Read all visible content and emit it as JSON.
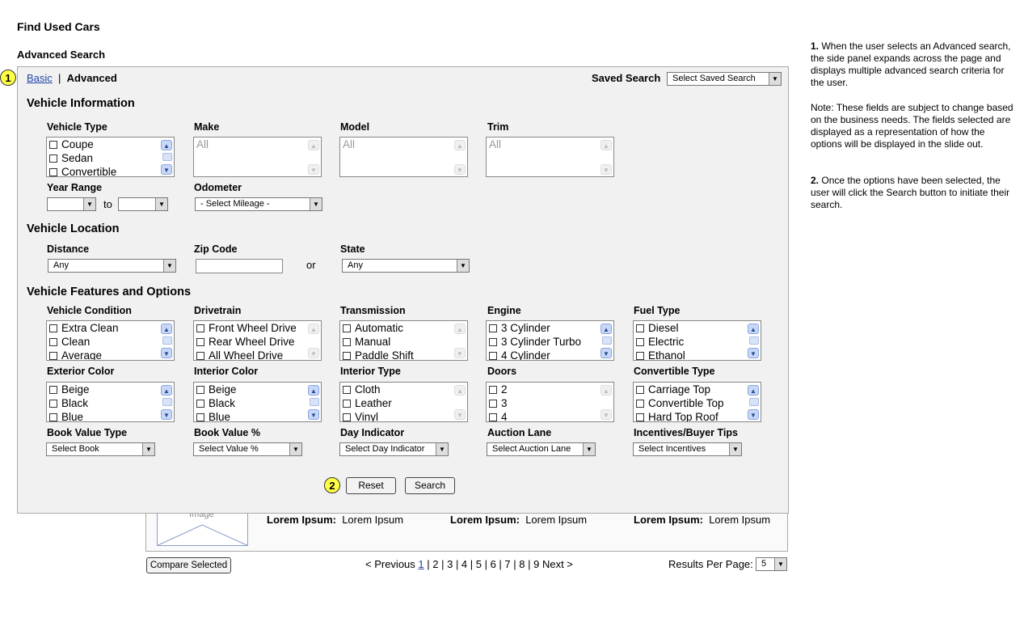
{
  "page": {
    "title": "Find Used Cars",
    "subtitle": "Advanced Search"
  },
  "tabs": {
    "basic": "Basic",
    "separator": "|",
    "advanced": "Advanced"
  },
  "saved_search": {
    "label": "Saved Search",
    "select_value": "Select Saved Search"
  },
  "badges": {
    "one": "1",
    "two": "2"
  },
  "sections": {
    "vehicle_information": "Vehicle Information",
    "vehicle_location": "Vehicle Location",
    "features": "Vehicle Features and Options"
  },
  "vehicle_info": {
    "vehicle_type": {
      "label": "Vehicle Type",
      "options": [
        "Coupe",
        "Sedan",
        "Convertible"
      ]
    },
    "make": {
      "label": "Make",
      "placeholder": "All"
    },
    "model": {
      "label": "Model",
      "placeholder": "All"
    },
    "trim": {
      "label": "Trim",
      "placeholder": "All"
    },
    "year_range": {
      "label": "Year Range",
      "to": "to"
    },
    "odometer": {
      "label": "Odometer",
      "select_value": "- Select Mileage -"
    }
  },
  "location": {
    "distance": {
      "label": "Distance",
      "select_value": "Any"
    },
    "zip": {
      "label": "Zip Code"
    },
    "or": "or",
    "state": {
      "label": "State",
      "select_value": "Any"
    }
  },
  "features": {
    "vehicle_condition": {
      "label": "Vehicle Condition",
      "options": [
        "Extra Clean",
        "Clean",
        "Average"
      ]
    },
    "drivetrain": {
      "label": "Drivetrain",
      "options": [
        "Front Wheel Drive",
        "Rear Wheel Drive",
        "All Wheel Drive"
      ]
    },
    "transmission": {
      "label": "Transmission",
      "options": [
        "Automatic",
        "Manual",
        "Paddle Shift"
      ]
    },
    "engine": {
      "label": "Engine",
      "options": [
        "3 Cylinder",
        "3 Cylinder Turbo",
        "4 Cylinder"
      ]
    },
    "fuel_type": {
      "label": "Fuel Type",
      "options": [
        "Diesel",
        "Electric",
        "Ethanol"
      ]
    },
    "exterior_color": {
      "label": "Exterior Color",
      "options": [
        "Beige",
        "Black",
        "Blue"
      ]
    },
    "interior_color": {
      "label": "Interior Color",
      "options": [
        "Beige",
        "Black",
        "Blue"
      ]
    },
    "interior_type": {
      "label": "Interior Type",
      "options": [
        "Cloth",
        "Leather",
        "Vinyl"
      ]
    },
    "doors": {
      "label": "Doors",
      "options": [
        "2",
        "3",
        "4"
      ]
    },
    "convertible_type": {
      "label": "Convertible Type",
      "options": [
        "Carriage Top",
        "Convertible Top",
        "Hard Top Roof"
      ]
    },
    "book_value_type": {
      "label": "Book Value Type",
      "select_value": "Select Book"
    },
    "book_value_pct": {
      "label": "Book Value %",
      "select_value": "Select Value %"
    },
    "day_indicator": {
      "label": "Day Indicator",
      "select_value": "Select Day Indicator"
    },
    "auction_lane": {
      "label": "Auction Lane",
      "select_value": "Select Auction Lane"
    },
    "incentives": {
      "label": "Incentives/Buyer Tips",
      "select_value": "Select Incentives"
    }
  },
  "buttons": {
    "reset": "Reset",
    "search": "Search",
    "compare": "Compare Selected"
  },
  "results": {
    "image_placeholder": "Image",
    "items": [
      {
        "label": "Lorem Ipsum:",
        "value": "Lorem Ipsum"
      },
      {
        "label": "Lorem Ipsum:",
        "value": "Lorem Ipsum"
      },
      {
        "label": "Lorem Ipsum:",
        "value": "Lorem Ipsum"
      }
    ]
  },
  "pagination": {
    "previous": "< Previous",
    "current": "1",
    "pages": "| 2 | 3 | 4 | 5 | 6 | 7 | 8 | 9",
    "next": "Next >",
    "per_page_label": "Results Per Page:",
    "per_page_value": "5"
  },
  "notes": {
    "n1_num": "1.",
    "n1_text": "When the user selects an Advanced search, the side panel expands across the page and displays multiple advanced search criteria for the user.",
    "note": "Note: These fields are subject to change based on the business needs. The fields selected are displayed as a representation of how the options will be displayed in the slide out.",
    "n2_num": "2.",
    "n2_text": "Once the options have been selected, the user will click the Search button to initiate their search."
  }
}
